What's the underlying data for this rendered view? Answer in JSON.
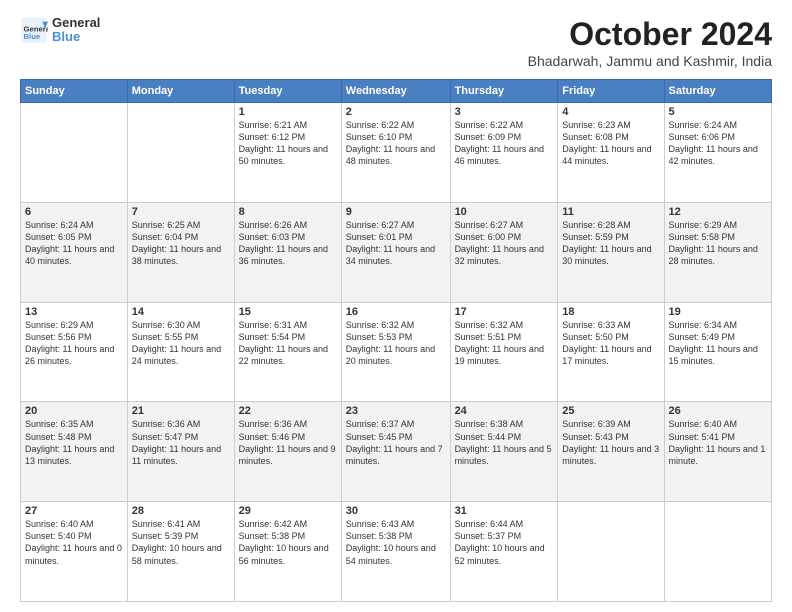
{
  "header": {
    "logo_general": "General",
    "logo_blue": "Blue",
    "month_title": "October 2024",
    "location": "Bhadarwah, Jammu and Kashmir, India"
  },
  "days_of_week": [
    "Sunday",
    "Monday",
    "Tuesday",
    "Wednesday",
    "Thursday",
    "Friday",
    "Saturday"
  ],
  "weeks": [
    [
      {
        "day": "",
        "info": ""
      },
      {
        "day": "",
        "info": ""
      },
      {
        "day": "1",
        "info": "Sunrise: 6:21 AM\nSunset: 6:12 PM\nDaylight: 11 hours and 50 minutes."
      },
      {
        "day": "2",
        "info": "Sunrise: 6:22 AM\nSunset: 6:10 PM\nDaylight: 11 hours and 48 minutes."
      },
      {
        "day": "3",
        "info": "Sunrise: 6:22 AM\nSunset: 6:09 PM\nDaylight: 11 hours and 46 minutes."
      },
      {
        "day": "4",
        "info": "Sunrise: 6:23 AM\nSunset: 6:08 PM\nDaylight: 11 hours and 44 minutes."
      },
      {
        "day": "5",
        "info": "Sunrise: 6:24 AM\nSunset: 6:06 PM\nDaylight: 11 hours and 42 minutes."
      }
    ],
    [
      {
        "day": "6",
        "info": "Sunrise: 6:24 AM\nSunset: 6:05 PM\nDaylight: 11 hours and 40 minutes."
      },
      {
        "day": "7",
        "info": "Sunrise: 6:25 AM\nSunset: 6:04 PM\nDaylight: 11 hours and 38 minutes."
      },
      {
        "day": "8",
        "info": "Sunrise: 6:26 AM\nSunset: 6:03 PM\nDaylight: 11 hours and 36 minutes."
      },
      {
        "day": "9",
        "info": "Sunrise: 6:27 AM\nSunset: 6:01 PM\nDaylight: 11 hours and 34 minutes."
      },
      {
        "day": "10",
        "info": "Sunrise: 6:27 AM\nSunset: 6:00 PM\nDaylight: 11 hours and 32 minutes."
      },
      {
        "day": "11",
        "info": "Sunrise: 6:28 AM\nSunset: 5:59 PM\nDaylight: 11 hours and 30 minutes."
      },
      {
        "day": "12",
        "info": "Sunrise: 6:29 AM\nSunset: 5:58 PM\nDaylight: 11 hours and 28 minutes."
      }
    ],
    [
      {
        "day": "13",
        "info": "Sunrise: 6:29 AM\nSunset: 5:56 PM\nDaylight: 11 hours and 26 minutes."
      },
      {
        "day": "14",
        "info": "Sunrise: 6:30 AM\nSunset: 5:55 PM\nDaylight: 11 hours and 24 minutes."
      },
      {
        "day": "15",
        "info": "Sunrise: 6:31 AM\nSunset: 5:54 PM\nDaylight: 11 hours and 22 minutes."
      },
      {
        "day": "16",
        "info": "Sunrise: 6:32 AM\nSunset: 5:53 PM\nDaylight: 11 hours and 20 minutes."
      },
      {
        "day": "17",
        "info": "Sunrise: 6:32 AM\nSunset: 5:51 PM\nDaylight: 11 hours and 19 minutes."
      },
      {
        "day": "18",
        "info": "Sunrise: 6:33 AM\nSunset: 5:50 PM\nDaylight: 11 hours and 17 minutes."
      },
      {
        "day": "19",
        "info": "Sunrise: 6:34 AM\nSunset: 5:49 PM\nDaylight: 11 hours and 15 minutes."
      }
    ],
    [
      {
        "day": "20",
        "info": "Sunrise: 6:35 AM\nSunset: 5:48 PM\nDaylight: 11 hours and 13 minutes."
      },
      {
        "day": "21",
        "info": "Sunrise: 6:36 AM\nSunset: 5:47 PM\nDaylight: 11 hours and 11 minutes."
      },
      {
        "day": "22",
        "info": "Sunrise: 6:36 AM\nSunset: 5:46 PM\nDaylight: 11 hours and 9 minutes."
      },
      {
        "day": "23",
        "info": "Sunrise: 6:37 AM\nSunset: 5:45 PM\nDaylight: 11 hours and 7 minutes."
      },
      {
        "day": "24",
        "info": "Sunrise: 6:38 AM\nSunset: 5:44 PM\nDaylight: 11 hours and 5 minutes."
      },
      {
        "day": "25",
        "info": "Sunrise: 6:39 AM\nSunset: 5:43 PM\nDaylight: 11 hours and 3 minutes."
      },
      {
        "day": "26",
        "info": "Sunrise: 6:40 AM\nSunset: 5:41 PM\nDaylight: 11 hours and 1 minute."
      }
    ],
    [
      {
        "day": "27",
        "info": "Sunrise: 6:40 AM\nSunset: 5:40 PM\nDaylight: 11 hours and 0 minutes."
      },
      {
        "day": "28",
        "info": "Sunrise: 6:41 AM\nSunset: 5:39 PM\nDaylight: 10 hours and 58 minutes."
      },
      {
        "day": "29",
        "info": "Sunrise: 6:42 AM\nSunset: 5:38 PM\nDaylight: 10 hours and 56 minutes."
      },
      {
        "day": "30",
        "info": "Sunrise: 6:43 AM\nSunset: 5:38 PM\nDaylight: 10 hours and 54 minutes."
      },
      {
        "day": "31",
        "info": "Sunrise: 6:44 AM\nSunset: 5:37 PM\nDaylight: 10 hours and 52 minutes."
      },
      {
        "day": "",
        "info": ""
      },
      {
        "day": "",
        "info": ""
      }
    ]
  ]
}
